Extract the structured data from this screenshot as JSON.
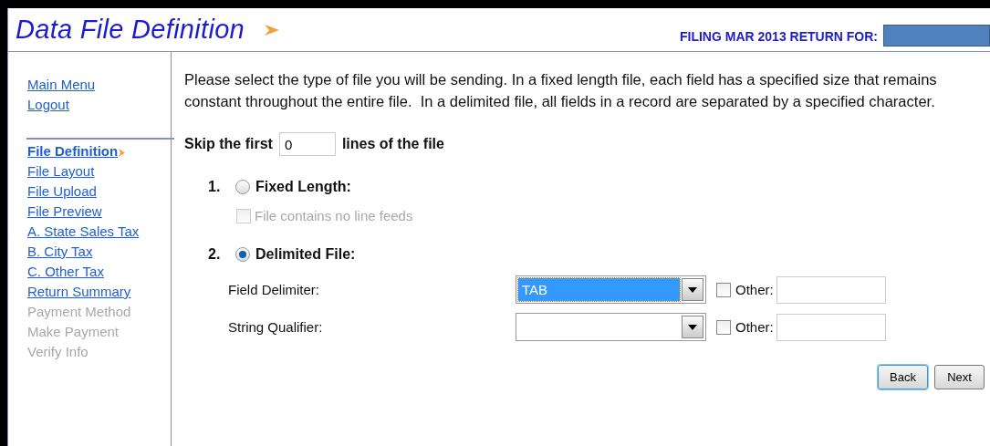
{
  "header": {
    "title": "Data File Definition",
    "filing": "FILING MAR 2013 RETURN FOR:"
  },
  "sidebar": {
    "links": [
      {
        "label": "Main Menu"
      },
      {
        "label": "Logout"
      }
    ],
    "steps": [
      {
        "label": "File Definition",
        "kind": "current"
      },
      {
        "label": "File Layout",
        "kind": "link"
      },
      {
        "label": "File Upload",
        "kind": "link"
      },
      {
        "label": "File Preview",
        "kind": "link"
      },
      {
        "label": "A. State Sales Tax",
        "kind": "link"
      },
      {
        "label": "B. City Tax",
        "kind": "link"
      },
      {
        "label": "C. Other Tax",
        "kind": "link"
      },
      {
        "label": "Return Summary",
        "kind": "link"
      },
      {
        "label": "Payment Method",
        "kind": "disabled"
      },
      {
        "label": "Make Payment",
        "kind": "disabled"
      },
      {
        "label": "Verify Info",
        "kind": "disabled"
      }
    ]
  },
  "intro": "Please select the type of file you will be sending. In a fixed length file, each field has a specified size that remains constant throughout the entire file.  In a delimited file, all fields in a record are separated by a specified character.",
  "skip": {
    "before": "Skip the first",
    "value": "0",
    "after": "lines of the file"
  },
  "options": [
    {
      "number": "1.",
      "label": "Fixed Length:",
      "selected": false,
      "sub": {
        "label": "File contains no line feeds",
        "checked": false,
        "disabled": true
      }
    },
    {
      "number": "2.",
      "label": "Delimited File:",
      "selected": true
    }
  ],
  "delimiters": [
    {
      "label": "Field Delimiter:",
      "value": "TAB",
      "highlighted": true,
      "other_label": "Other:",
      "other_checked": false
    },
    {
      "label": "String Qualifier:",
      "highlighted": false,
      "other_label": "Other:",
      "other_checked": false
    }
  ],
  "buttons": [
    {
      "label": "Back",
      "focused": true
    },
    {
      "label": "Next",
      "focused": false
    }
  ]
}
